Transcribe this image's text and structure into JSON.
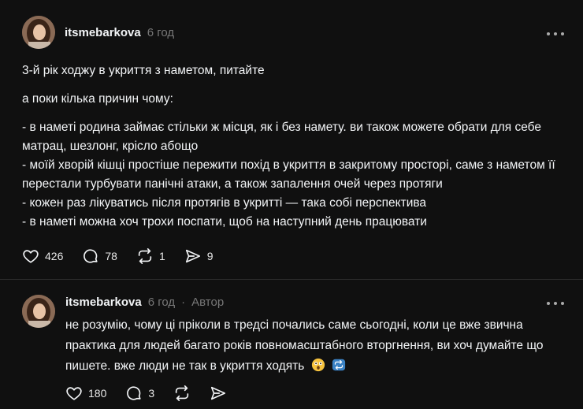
{
  "post": {
    "username": "itsmebarkova",
    "time": "6 год",
    "paragraphs": [
      "3-й рік ходжу в укриття з наметом, питайте",
      "а поки кілька причин чому:",
      "- в наметі родина займає стільки ж місця, як і без намету. ви також можете обрати для себе матрац, шезлонг, крісло абощо\n- моїй хворій кішці простіше пережити похід в укриття в закритому просторі, саме з наметом її перестали турбувати панічні атаки, а також запалення очей через протяги\n- кожен раз лікуватись після протягів в укритті — така собі перспектива\n- в наметі можна хоч трохи поспати, щоб на наступний день працювати"
    ],
    "actions": {
      "likes": "426",
      "comments": "78",
      "reposts": "1",
      "shares": "9"
    }
  },
  "reply": {
    "username": "itsmebarkova",
    "time": "6 год",
    "separator": "·",
    "author_label": "Автор",
    "text": "не розумію, чому ці пріколи в тредсі почались саме сьогодні, коли це вже звична практика для людей багато років повномасштабного вторгнення, ви хоч думайте що пишете. вже люди не так в укриття ходять",
    "emojis": [
      "astonished-face-icon",
      "repeat-arrows-icon"
    ],
    "actions": {
      "likes": "180",
      "comments": "3"
    }
  },
  "colors": {
    "background": "#101010",
    "text": "#f3f5f7",
    "muted": "#777777",
    "divider": "#2d2d2d"
  }
}
